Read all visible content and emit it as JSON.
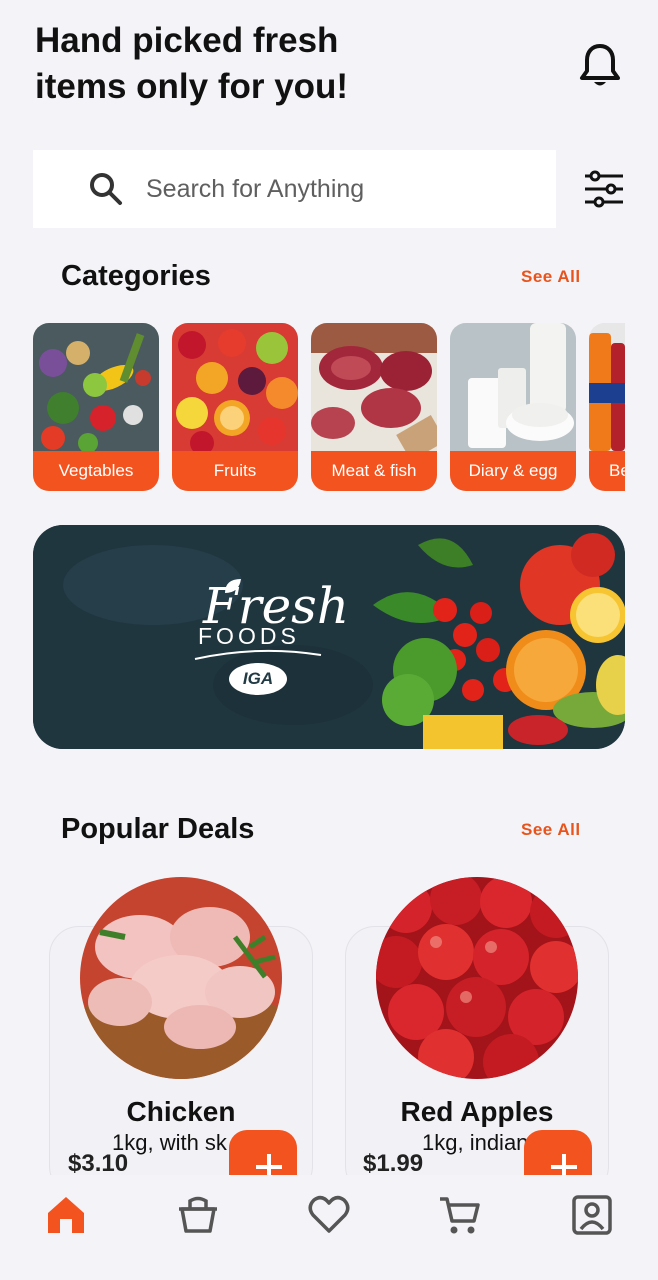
{
  "header": {
    "title": "Hand picked fresh items only for you!"
  },
  "search": {
    "placeholder": "Search for Anything"
  },
  "categories": {
    "title": "Categories",
    "see_all": "See All",
    "items": [
      {
        "label": "Vegtables"
      },
      {
        "label": "Fruits"
      },
      {
        "label": "Meat & fish"
      },
      {
        "label": "Diary & egg"
      },
      {
        "label": "Be"
      }
    ]
  },
  "banner": {
    "logo_word": "Fresh",
    "logo_sub": "FOODS",
    "logo_badge": "IGA"
  },
  "popular": {
    "title": "Popular Deals",
    "see_all": "See All",
    "items": [
      {
        "name": "Chicken",
        "desc": "1kg, with sk",
        "price": "$3.10"
      },
      {
        "name": "Red Apples",
        "desc": "1kg, indian",
        "price": "$1.99"
      }
    ]
  },
  "nav": {
    "items": [
      {
        "icon": "home-icon",
        "active": true
      },
      {
        "icon": "basket-icon",
        "active": false
      },
      {
        "icon": "heart-icon",
        "active": false
      },
      {
        "icon": "cart-icon",
        "active": false
      },
      {
        "icon": "profile-icon",
        "active": false
      }
    ]
  },
  "colors": {
    "accent": "#f3531f",
    "see_all": "#e8541c",
    "background": "#f4f3f7"
  }
}
